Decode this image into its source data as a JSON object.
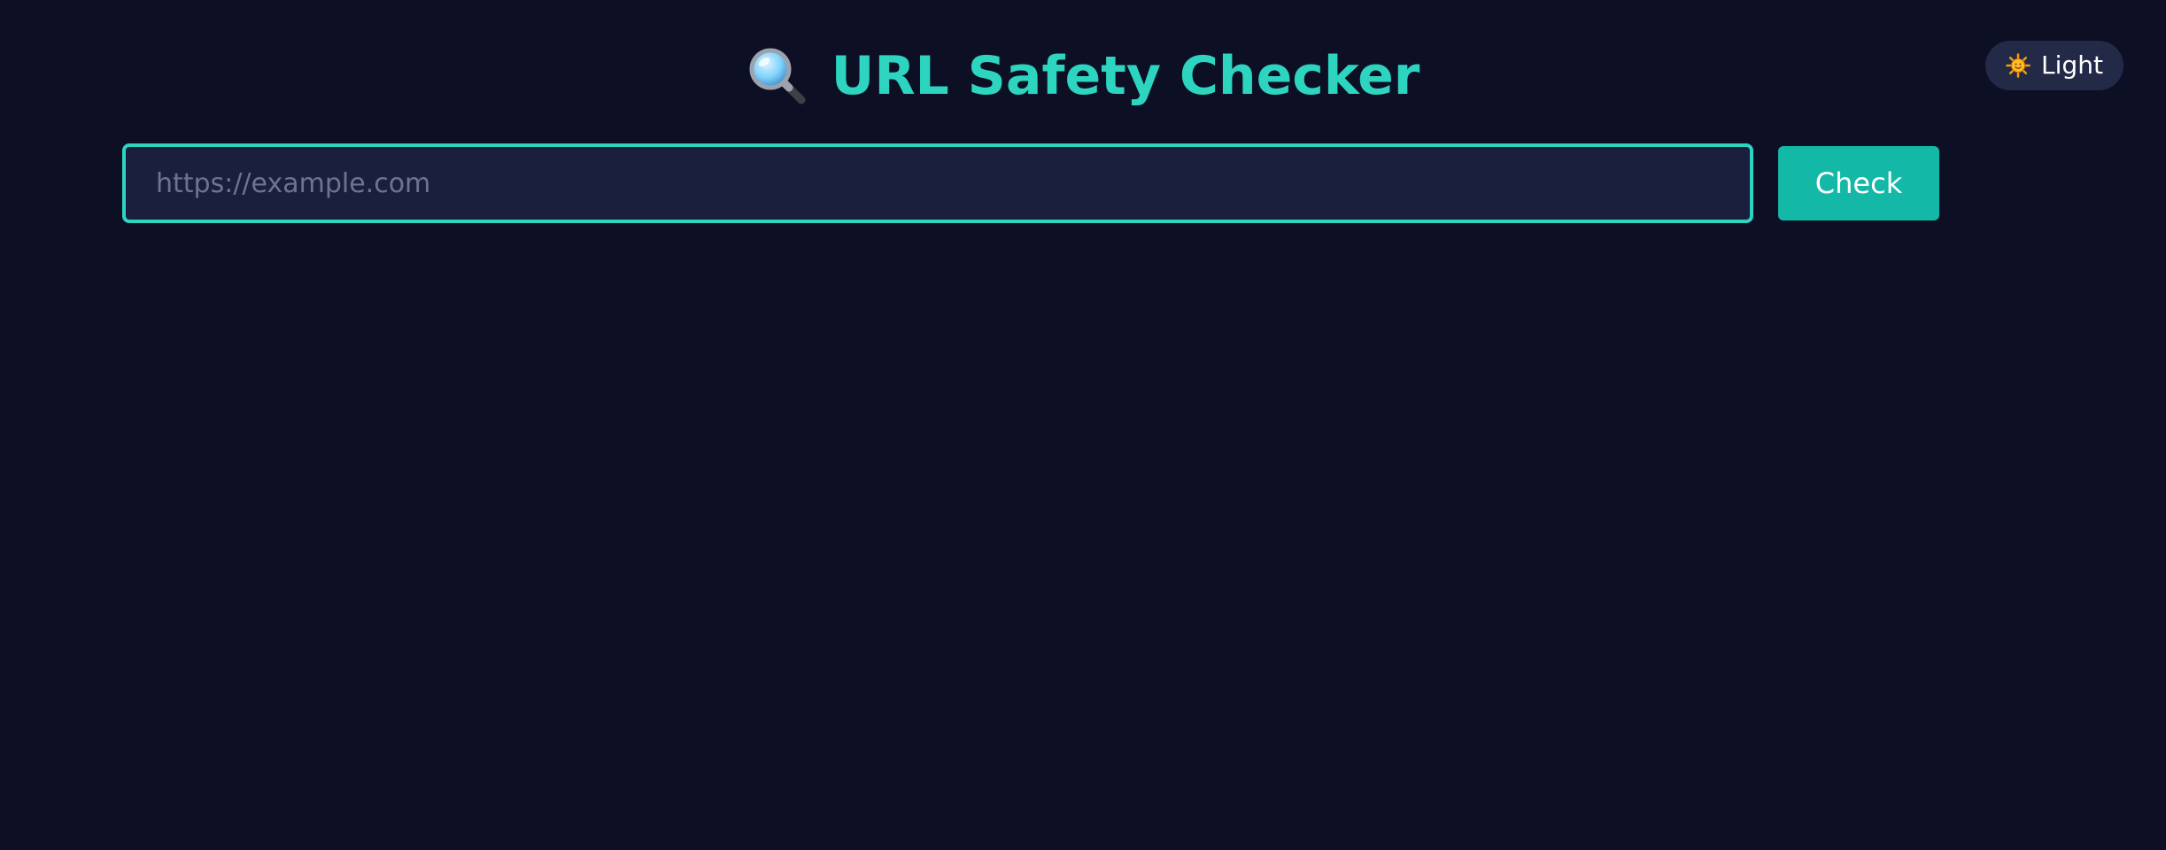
{
  "app": {
    "title": "URL Safety Checker",
    "title_icon": "magnifying-glass-icon"
  },
  "theme_toggle": {
    "label": "Light",
    "icon": "sun-icon"
  },
  "search": {
    "value": "",
    "placeholder": "https://example.com",
    "button_label": "Check"
  },
  "colors": {
    "background": "#0d1024",
    "accent": "#2dd4bf",
    "button": "#14b8a6",
    "input_bg": "#1a1f3d",
    "toggle_bg": "#232a48"
  }
}
